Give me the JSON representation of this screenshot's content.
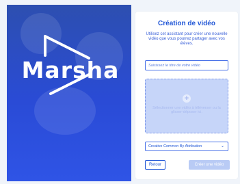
{
  "brand": {
    "logo_text": "Marsha"
  },
  "wizard": {
    "title": "Création de vidéo",
    "description": "Utilisez cet assistant pour créer une nouvelle vidéo que vous pourrez partager avec vos élèves.",
    "title_placeholder": "Saisissez le titre de votre vidéo",
    "dropzone_text": "Sélectionner une vidéo à téléverser ou la glisser-déposer ici.",
    "license_selected": "Creative Common By Attribution",
    "back_label": "Retour",
    "create_label": "Créer une vidéo"
  },
  "colors": {
    "accent": "#1f55d6",
    "panel_gradient_top": "#2d4fb0",
    "panel_gradient_bottom": "#2f54e6",
    "dropzone_bg": "#c6d5f9",
    "disabled_button": "#b9cbf5"
  },
  "icons": {
    "add": "plus-circle-icon",
    "select": "chevron-down-icon",
    "logo": "play-triangle-icon"
  }
}
